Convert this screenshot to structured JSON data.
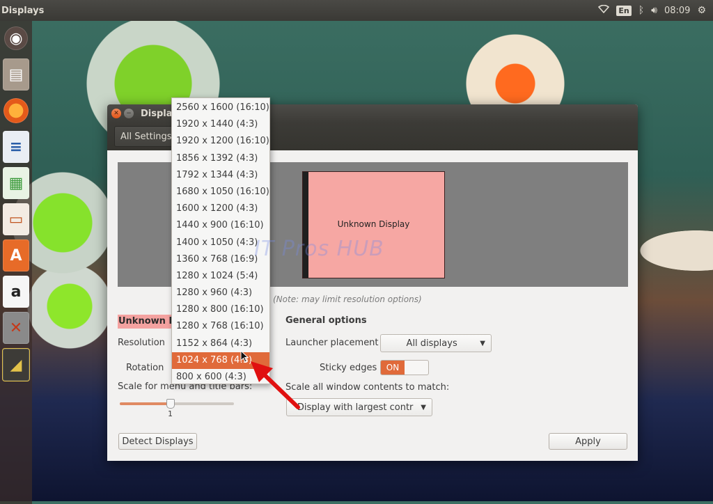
{
  "top_panel": {
    "title": "Displays",
    "keyboard_layout": "En",
    "time": "08:09"
  },
  "launcher": {
    "items": [
      {
        "name": "ubuntu-dash",
        "glyph": "◉"
      },
      {
        "name": "files",
        "glyph": "▤"
      },
      {
        "name": "firefox",
        "glyph": ""
      },
      {
        "name": "libreoffice-writer",
        "glyph": "≡"
      },
      {
        "name": "libreoffice-calc",
        "glyph": "▦"
      },
      {
        "name": "libreoffice-impress",
        "glyph": "▭"
      },
      {
        "name": "software-center",
        "glyph": "A"
      },
      {
        "name": "amazon",
        "glyph": "a"
      },
      {
        "name": "system-settings",
        "glyph": "✕"
      },
      {
        "name": "workspace-switcher",
        "glyph": "◢"
      }
    ]
  },
  "window": {
    "title": "Displays",
    "all_settings_label": "All Settings",
    "monitor_label": "Unknown Display",
    "note_text": "(Note: may limit resolution options)",
    "display_name": "Unknown Display",
    "resolution_label": "Resolution",
    "rotation_label": "Rotation",
    "scale_label": "Scale for menu and title bars:",
    "scale_value": "1",
    "scale_level": 0.45,
    "general_heading": "General options",
    "launcher_placement_label": "Launcher placement",
    "launcher_placement_value": "All displays",
    "sticky_edges_label": "Sticky edges",
    "sticky_edges_state": "ON",
    "scale_all_label": "Scale all window contents to match:",
    "scale_all_value": "Display with largest contr",
    "detect_button": "Detect Displays",
    "apply_button": "Apply"
  },
  "resolution_dropdown": {
    "options": [
      "2560 x 1600 (16:10)",
      "1920 x 1440 (4:3)",
      "1920 x 1200 (16:10)",
      "1856 x 1392 (4:3)",
      "1792 x 1344 (4:3)",
      "1680 x 1050 (16:10)",
      "1600 x 1200 (4:3)",
      "1440 x 900 (16:10)",
      "1400 x 1050 (4:3)",
      "1360 x 768 (16:9)",
      "1280 x 1024 (5:4)",
      "1280 x 960 (4:3)",
      "1280 x 800 (16:10)",
      "1280 x 768 (16:10)",
      "1152 x 864 (4:3)",
      "1024 x 768 (4:3)",
      "800 x 600 (4:3)"
    ],
    "selected_index": 15
  },
  "watermark": "IT Pros HUB",
  "colors": {
    "accent": "#e06a3a",
    "monitor_fill": "#f6a7a3",
    "panel": "#3c3b37",
    "arrow": "#e01010"
  }
}
